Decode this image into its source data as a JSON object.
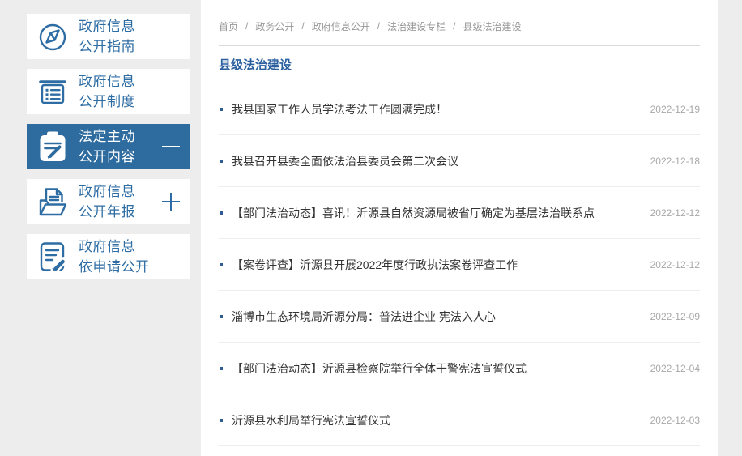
{
  "colors": {
    "page_bg": "#ededed",
    "accent_blue": "#2e6da4",
    "active_item_bg": "#2e6b9e",
    "title_blue": "#2a5f9e",
    "article_text": "#333333",
    "date_text": "#a8a8a8",
    "breadcrumb_text": "#999999"
  },
  "sidebar": {
    "items": [
      {
        "line1": "政府信息",
        "line2": "公开指南",
        "icon": "compass-icon",
        "active": false,
        "expand": "none"
      },
      {
        "line1": "政府信息",
        "line2": "公开制度",
        "icon": "news-list-icon",
        "active": false,
        "expand": "none"
      },
      {
        "line1": "法定主动",
        "line2": "公开内容",
        "icon": "clipboard-pencil-icon",
        "active": true,
        "expand": "minus"
      },
      {
        "line1": "政府信息",
        "line2": "公开年报",
        "icon": "folder-document-icon",
        "active": false,
        "expand": "plus"
      },
      {
        "line1": "政府信息",
        "line2": "依申请公开",
        "icon": "document-pencil-icon",
        "active": false,
        "expand": "none"
      }
    ]
  },
  "breadcrumb": {
    "separator": "/",
    "items": [
      "首页",
      "政务公开",
      "政府信息公开",
      "法治建设专栏",
      "县级法治建设"
    ]
  },
  "content": {
    "title": "县级法治建设",
    "articles": [
      {
        "title": "我县国家工作人员学法考法工作圆满完成！",
        "date": "2022-12-19"
      },
      {
        "title": "我县召开县委全面依法治县委员会第二次会议",
        "date": "2022-12-18"
      },
      {
        "title": "【部门法治动态】喜讯！沂源县自然资源局被省厅确定为基层法治联系点",
        "date": "2022-12-12"
      },
      {
        "title": "【案卷评查】沂源县开展2022年度行政执法案卷评查工作",
        "date": "2022-12-12"
      },
      {
        "title": "淄博市生态环境局沂源分局：普法进企业 宪法入人心",
        "date": "2022-12-09"
      },
      {
        "title": "【部门法治动态】沂源县检察院举行全体干警宪法宣誓仪式",
        "date": "2022-12-04"
      },
      {
        "title": "沂源县水利局举行宪法宣誓仪式",
        "date": "2022-12-03"
      }
    ]
  }
}
